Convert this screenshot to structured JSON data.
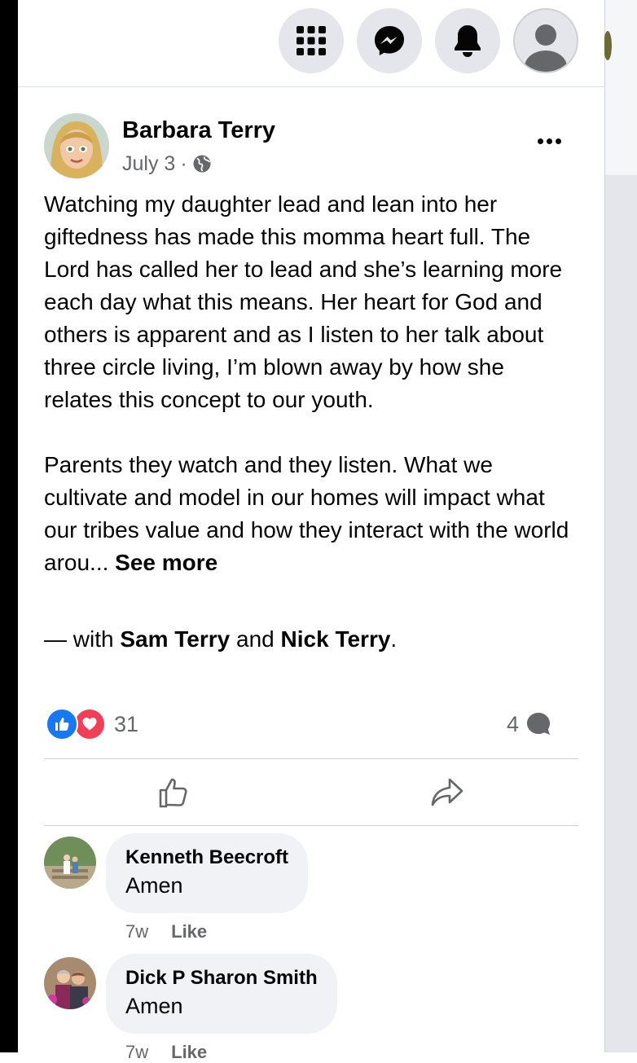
{
  "topbar": {
    "icons": [
      "grid-menu-icon",
      "messenger-icon",
      "bell-icon",
      "profile-icon"
    ]
  },
  "post": {
    "author": "Barbara Terry",
    "date": "July 3",
    "separator": "·",
    "privacy_icon": "globe-icon",
    "paragraph1": "Watching my daughter lead and lean into her giftedness has made this momma heart full. The Lord has called her to lead and she’s learning more each day what this means. Her heart for God and others is apparent and as I listen to her talk about three circle living, I’m blown away by how she relates this concept to our youth.",
    "paragraph2": "Parents they watch and they listen. What we cultivate and model in our homes will impact what our tribes value and how they interact with the world arou...",
    "see_more": "See more",
    "tag_prefix": "— with",
    "tag_person1": "Sam Terry",
    "tag_joiner": "and",
    "tag_person2": "Nick Terry",
    "tag_suffix": ".",
    "reaction_count": "31",
    "comment_count": "4"
  },
  "actions": {
    "like_icon": "thumbs-up-icon",
    "share_icon": "share-arrow-icon"
  },
  "comments": [
    {
      "name": "Kenneth Beecroft",
      "text": "Amen",
      "time": "7w",
      "like": "Like"
    },
    {
      "name": "Dick P Sharon Smith",
      "text": "Amen",
      "time": "7w",
      "like": "Like"
    }
  ],
  "colors": {
    "like_blue": "#1877f2",
    "love_red": "#f33e58",
    "secondary_text": "#65676b",
    "bubble_bg": "#f0f2f5"
  }
}
